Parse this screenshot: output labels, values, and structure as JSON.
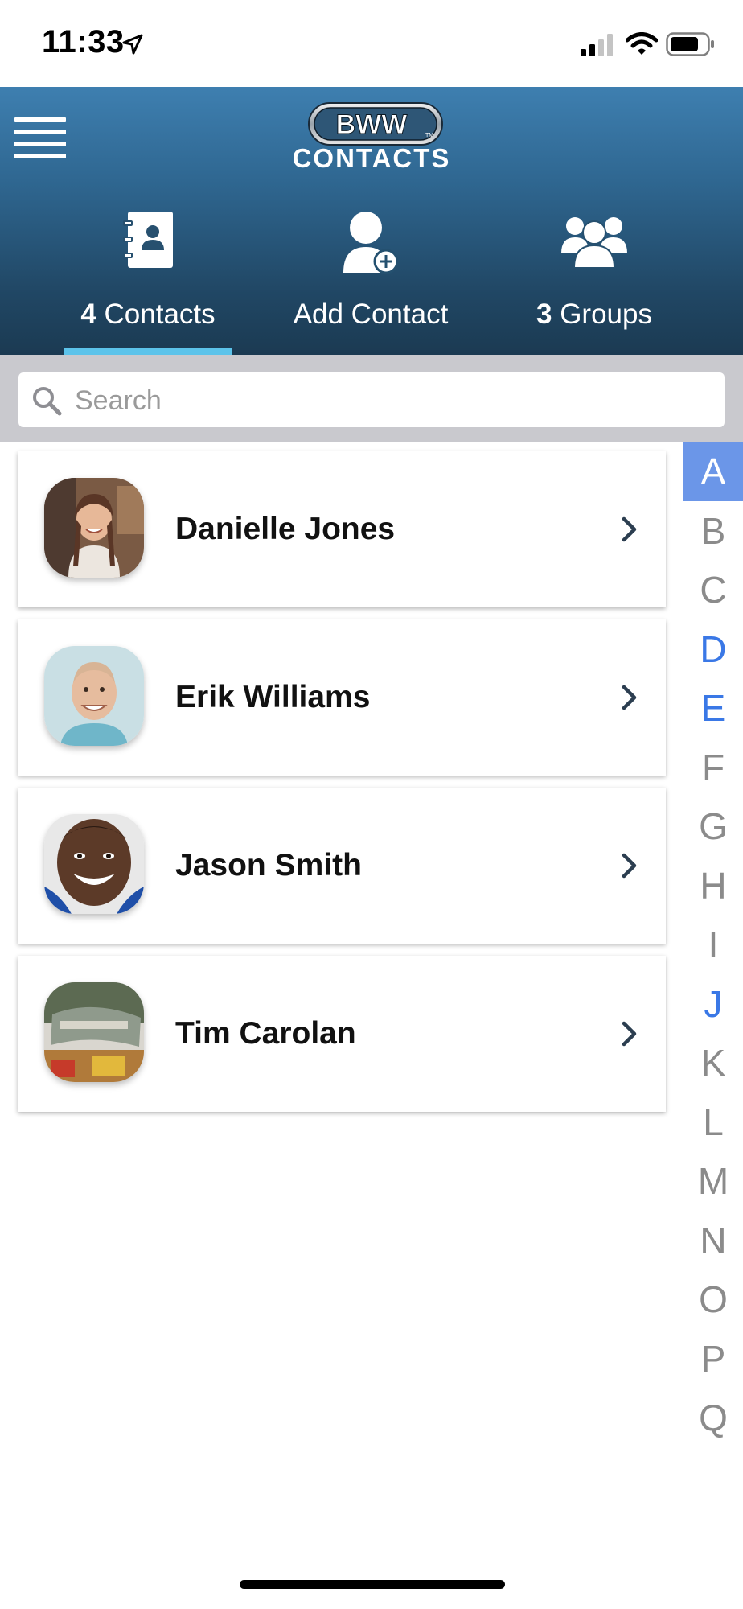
{
  "status_bar": {
    "time": "11:33"
  },
  "header": {
    "logo_text": "BWW",
    "logo_tm": "TM",
    "title": "CONTACTS"
  },
  "tabs": [
    {
      "count": "4",
      "label": " Contacts",
      "icon": "address-book-icon",
      "active": true
    },
    {
      "count": "",
      "label": "Add Contact",
      "icon": "add-user-icon",
      "active": false
    },
    {
      "count": "3",
      "label": " Groups",
      "icon": "groups-icon",
      "active": false
    }
  ],
  "search": {
    "placeholder": "Search",
    "value": ""
  },
  "contacts": [
    {
      "name": "Danielle Jones"
    },
    {
      "name": "Erik Williams"
    },
    {
      "name": "Jason Smith"
    },
    {
      "name": "Tim Carolan"
    }
  ],
  "alphabet_index": {
    "letters": [
      "A",
      "B",
      "C",
      "D",
      "E",
      "F",
      "G",
      "H",
      "I",
      "J",
      "K",
      "L",
      "M",
      "N",
      "O",
      "P",
      "Q"
    ],
    "selected": "A",
    "with_contacts": [
      "D",
      "E",
      "J"
    ]
  },
  "colors": {
    "header_top": "#3e7fb0",
    "header_bottom": "#1b3a52",
    "tab_underline": "#5cc3ea",
    "index_selected": "#6b96e8",
    "index_has_contacts": "#3a78e6"
  }
}
